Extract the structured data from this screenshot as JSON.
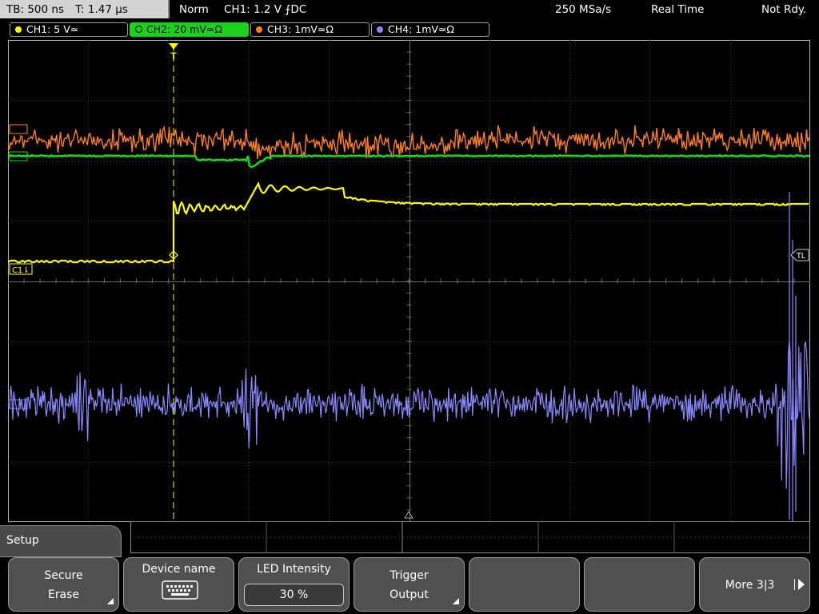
{
  "status": {
    "timebase": "TB: 500 ns",
    "trigger_time": "T: 1.47 µs",
    "acq_mode": "Norm",
    "trigger_setting": "CH1: 1.2 V ⨍DC",
    "sample_rate": "250 MSa/s",
    "acquisition": "Real Time",
    "state": "Not Rdy."
  },
  "channels": [
    {
      "label": "CH1: 5 V≃",
      "color": "#ffff00"
    },
    {
      "label": "CH2: 20 mV≃Ω",
      "color": "#1bd11b"
    },
    {
      "label": "CH3: 1mV≃Ω",
      "color": "#ff7f1e"
    },
    {
      "label": "CH4: 1mV≃Ω",
      "color": "#8a8aff"
    }
  ],
  "screen": {
    "ch1_marker": "C1⇂",
    "trigger_level_marker": "TL",
    "trigger_marker": "T"
  },
  "menu": {
    "title": "Setup",
    "softkeys": {
      "secure_erase_line1": "Secure",
      "secure_erase_line2": "Erase",
      "device_name": "Device name",
      "led_label": "LED Intensity",
      "led_value": "30 %",
      "trigger_output_line1": "Trigger",
      "trigger_output_line2": "Output",
      "more": "More 3|3"
    }
  }
}
